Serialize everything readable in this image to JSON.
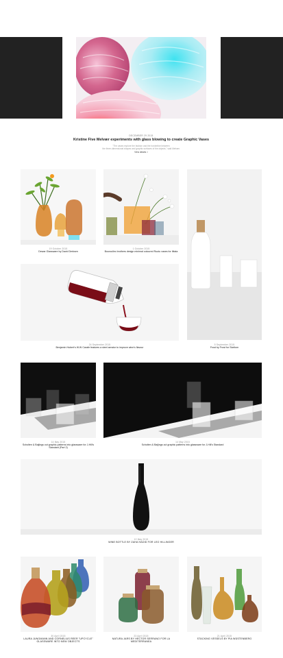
{
  "hero": {
    "date": "December 29 2015",
    "title": "Kristine Five Melvær experiments with glass blowing to create Graphic Vases",
    "excerpt_line1": "\"The vases explore the fashion and the borderline between",
    "excerpt_line2": "the three-dimensional shapes and graphic surfaces of the objects,\" said Melvær.",
    "more": "View details >"
  },
  "posts": [
    {
      "date": "19 October 2015",
      "title": "Dewar Glassware by David Derksen"
    },
    {
      "date": "1 October 2015",
      "title": "Bouroullec brothers design minimal coloured Ruutu vases for Iittala"
    },
    {
      "date": "24 September 2015",
      "title": "Benjamin Hubert's W.W Carafe features a steel aerator to improve wine's flavour"
    },
    {
      "date": "5 September 2015",
      "title": "Frost by Frost for Skeltom"
    },
    {
      "date": "14 May 2015",
      "title": "Scholten & Baijings cut graphic patterns into glassware for J-Hill's Standard (Part 2)"
    },
    {
      "date": "14 May 2015",
      "title": "Scholten & Baijings cut graphic patterns into glassware for J-Hill's Standard"
    },
    {
      "date": "12 May 2015",
      "title": "WINE BOTTLE BY ZAHA HADID FOR LEO HILLINGER"
    },
    {
      "date": "30 April 2015",
      "title": "LAURA JUNGMANN AND CORNELIUS REER \"UPCYCLE\" GLASSWARE INTO NEW OBJECTS"
    },
    {
      "date": "23 April 2015",
      "title": "NATURA JARS BY HECTOR SERRANO FOR LA MEDITERRANEA"
    },
    {
      "date": "21 April 2015",
      "title": "STACKING VESSELS BY PIA WÜSTENBERG"
    }
  ],
  "colors": {
    "dark_panel": "#222222",
    "background": "#ffffff"
  },
  "icons": [
    "glass-vase-photo",
    "carafe-photo",
    "wine-bottle-photo"
  ]
}
